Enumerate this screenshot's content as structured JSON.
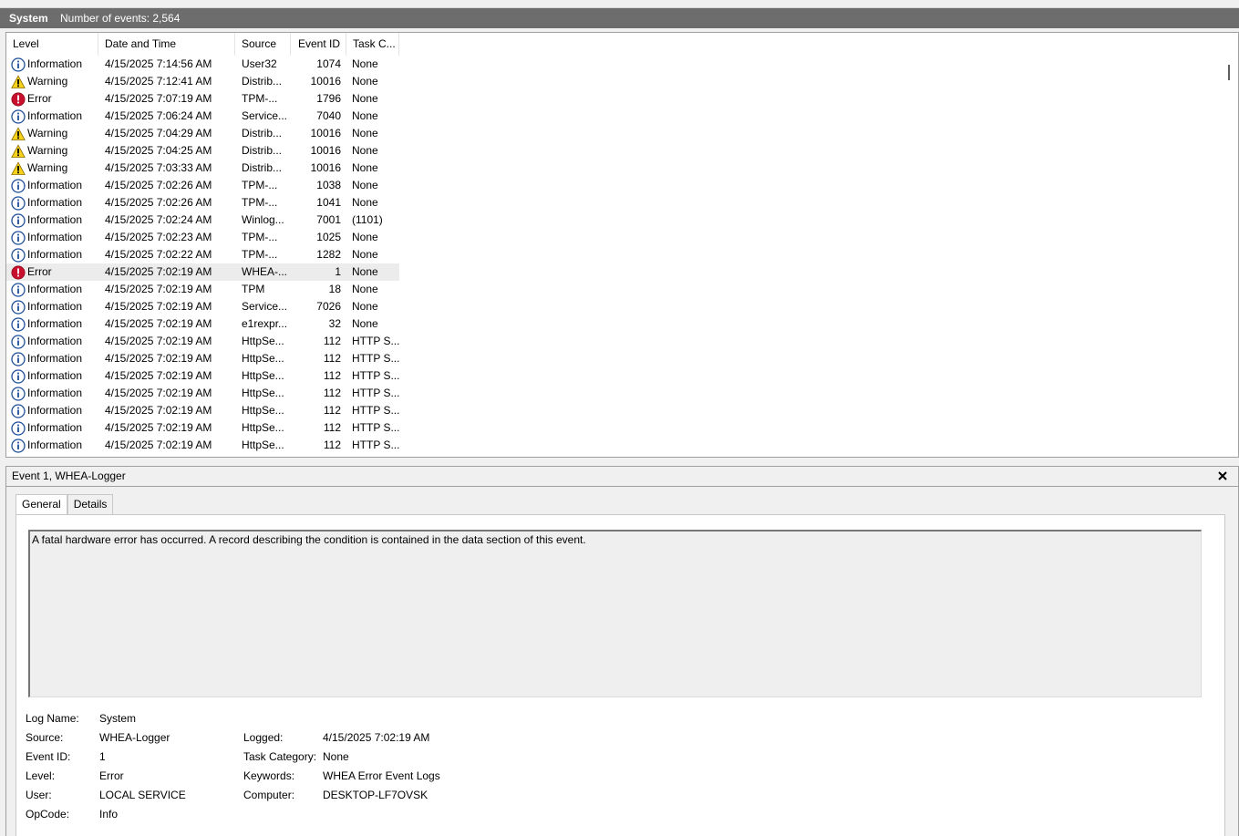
{
  "header": {
    "log_name": "System",
    "event_count_text": "Number of events: 2,564"
  },
  "grid": {
    "columns": {
      "level": "Level",
      "date": "Date and Time",
      "source": "Source",
      "event_id": "Event ID",
      "task": "Task C..."
    },
    "rows": [
      {
        "level": "Information",
        "icon": "information-icon",
        "date": "4/15/2025 7:14:56 AM",
        "source": "User32",
        "event_id": "1074",
        "task": "None"
      },
      {
        "level": "Warning",
        "icon": "warning-icon",
        "date": "4/15/2025 7:12:41 AM",
        "source": "Distrib...",
        "event_id": "10016",
        "task": "None"
      },
      {
        "level": "Error",
        "icon": "error-icon",
        "date": "4/15/2025 7:07:19 AM",
        "source": "TPM-...",
        "event_id": "1796",
        "task": "None"
      },
      {
        "level": "Information",
        "icon": "information-icon",
        "date": "4/15/2025 7:06:24 AM",
        "source": "Service...",
        "event_id": "7040",
        "task": "None"
      },
      {
        "level": "Warning",
        "icon": "warning-icon",
        "date": "4/15/2025 7:04:29 AM",
        "source": "Distrib...",
        "event_id": "10016",
        "task": "None"
      },
      {
        "level": "Warning",
        "icon": "warning-icon",
        "date": "4/15/2025 7:04:25 AM",
        "source": "Distrib...",
        "event_id": "10016",
        "task": "None"
      },
      {
        "level": "Warning",
        "icon": "warning-icon",
        "date": "4/15/2025 7:03:33 AM",
        "source": "Distrib...",
        "event_id": "10016",
        "task": "None"
      },
      {
        "level": "Information",
        "icon": "information-icon",
        "date": "4/15/2025 7:02:26 AM",
        "source": "TPM-...",
        "event_id": "1038",
        "task": "None"
      },
      {
        "level": "Information",
        "icon": "information-icon",
        "date": "4/15/2025 7:02:26 AM",
        "source": "TPM-...",
        "event_id": "1041",
        "task": "None"
      },
      {
        "level": "Information",
        "icon": "information-icon",
        "date": "4/15/2025 7:02:24 AM",
        "source": "Winlog...",
        "event_id": "7001",
        "task": "(1101)"
      },
      {
        "level": "Information",
        "icon": "information-icon",
        "date": "4/15/2025 7:02:23 AM",
        "source": "TPM-...",
        "event_id": "1025",
        "task": "None"
      },
      {
        "level": "Information",
        "icon": "information-icon",
        "date": "4/15/2025 7:02:22 AM",
        "source": "TPM-...",
        "event_id": "1282",
        "task": "None"
      },
      {
        "level": "Error",
        "icon": "error-icon",
        "date": "4/15/2025 7:02:19 AM",
        "source": "WHEA-...",
        "event_id": "1",
        "task": "None",
        "selected": true
      },
      {
        "level": "Information",
        "icon": "information-icon",
        "date": "4/15/2025 7:02:19 AM",
        "source": "TPM",
        "event_id": "18",
        "task": "None"
      },
      {
        "level": "Information",
        "icon": "information-icon",
        "date": "4/15/2025 7:02:19 AM",
        "source": "Service...",
        "event_id": "7026",
        "task": "None"
      },
      {
        "level": "Information",
        "icon": "information-icon",
        "date": "4/15/2025 7:02:19 AM",
        "source": "e1rexpr...",
        "event_id": "32",
        "task": "None"
      },
      {
        "level": "Information",
        "icon": "information-icon",
        "date": "4/15/2025 7:02:19 AM",
        "source": "HttpSe...",
        "event_id": "112",
        "task": "HTTP S..."
      },
      {
        "level": "Information",
        "icon": "information-icon",
        "date": "4/15/2025 7:02:19 AM",
        "source": "HttpSe...",
        "event_id": "112",
        "task": "HTTP S..."
      },
      {
        "level": "Information",
        "icon": "information-icon",
        "date": "4/15/2025 7:02:19 AM",
        "source": "HttpSe...",
        "event_id": "112",
        "task": "HTTP S..."
      },
      {
        "level": "Information",
        "icon": "information-icon",
        "date": "4/15/2025 7:02:19 AM",
        "source": "HttpSe...",
        "event_id": "112",
        "task": "HTTP S..."
      },
      {
        "level": "Information",
        "icon": "information-icon",
        "date": "4/15/2025 7:02:19 AM",
        "source": "HttpSe...",
        "event_id": "112",
        "task": "HTTP S..."
      },
      {
        "level": "Information",
        "icon": "information-icon",
        "date": "4/15/2025 7:02:19 AM",
        "source": "HttpSe...",
        "event_id": "112",
        "task": "HTTP S..."
      },
      {
        "level": "Information",
        "icon": "information-icon",
        "date": "4/15/2025 7:02:19 AM",
        "source": "HttpSe...",
        "event_id": "112",
        "task": "HTTP S..."
      }
    ]
  },
  "detail": {
    "title": "Event 1, WHEA-Logger",
    "tabs": {
      "general": "General",
      "details": "Details"
    },
    "message": "A fatal hardware error has occurred. A record describing the condition is contained in the data section of this event.",
    "properties": {
      "log_name_label": "Log Name:",
      "log_name": "System",
      "source_label": "Source:",
      "source": "WHEA-Logger",
      "logged_label": "Logged:",
      "logged": "4/15/2025 7:02:19 AM",
      "event_id_label": "Event ID:",
      "event_id": "1",
      "task_category_label": "Task Category:",
      "task_category": "None",
      "level_label": "Level:",
      "level": "Error",
      "keywords_label": "Keywords:",
      "keywords": "WHEA Error Event Logs",
      "user_label": "User:",
      "user": "LOCAL SERVICE",
      "computer_label": "Computer:",
      "computer": "DESKTOP-LF7OVSK",
      "opcode_label": "OpCode:",
      "opcode": "Info"
    }
  },
  "colors": {
    "titlebar": "#6d6d6d",
    "information": "#1f4e99",
    "warning": "#f6d21a",
    "error": "#c8102e",
    "selected_row": "#ececec"
  }
}
